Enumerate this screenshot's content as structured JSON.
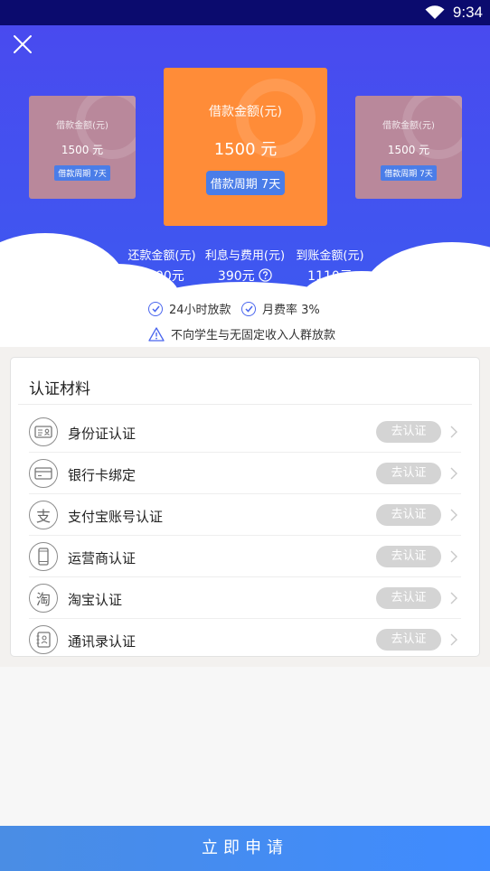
{
  "status_bar": {
    "time": "9:34"
  },
  "loan_cards": {
    "side_title": "借款金额(元)",
    "side_amount": "1500 元",
    "side_period": "借款周期 7天",
    "main_title": "借款金额(元)",
    "main_amount": "1500 元",
    "main_period": "借款周期 7天"
  },
  "stats": [
    {
      "label": "还款金额(元)",
      "value": "1500元"
    },
    {
      "label": "利息与费用(元)",
      "value": "390元"
    },
    {
      "label": "到账金额(元)",
      "value": "1110元"
    }
  ],
  "notices": {
    "fast_payout": "24小时放款",
    "monthly_rate": "月费率 3%",
    "warning": "不向学生与无固定收入人群放款"
  },
  "auth_panel": {
    "title": "认证材料",
    "button_label": "去认证",
    "items": [
      {
        "label": "身份证认证",
        "icon": "id-card-icon"
      },
      {
        "label": "银行卡绑定",
        "icon": "bank-card-icon"
      },
      {
        "label": "支付宝账号认证",
        "icon": "alipay-icon",
        "glyph": "支"
      },
      {
        "label": "运营商认证",
        "icon": "phone-icon"
      },
      {
        "label": "淘宝认证",
        "icon": "taobao-icon",
        "glyph": "淘"
      },
      {
        "label": "通讯录认证",
        "icon": "contacts-icon"
      }
    ]
  },
  "apply_button": {
    "label": "立即申请"
  },
  "colors": {
    "hero_blue": "#4a49ef",
    "card_orange": "#ff8c38",
    "tag_blue": "#4a7de8",
    "button_blue": "#3f8bff",
    "disabled_gray": "#d4d4d4"
  }
}
